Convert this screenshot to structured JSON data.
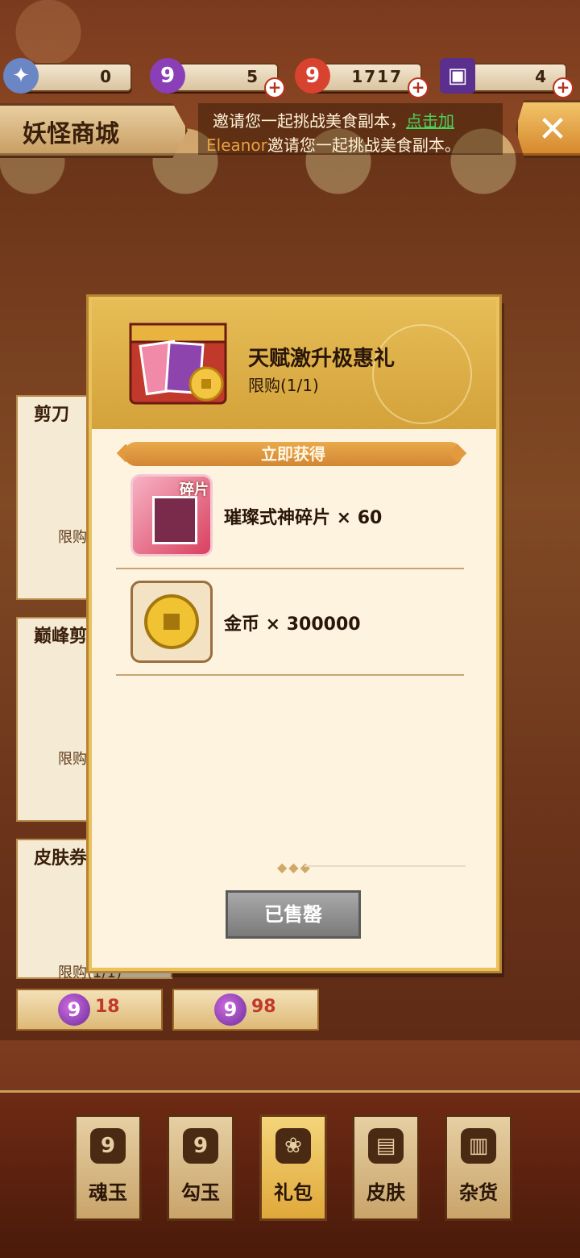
{
  "resources": [
    {
      "icon": "soul-bird-icon",
      "value": "0",
      "color": "#6b86c4"
    },
    {
      "icon": "magatama-purple-icon",
      "value": "5",
      "color": "#8a3fb8"
    },
    {
      "icon": "magatama-red-icon",
      "value": "1717",
      "color": "#d8432f"
    },
    {
      "icon": "ticket-card-icon",
      "value": "4",
      "color": "#5b2f8e"
    }
  ],
  "header": {
    "title": "妖怪商城",
    "marquee_line1": "邀请您一起挑战美食副本，",
    "marquee_link": "点击加",
    "marquee_name": "Eleanor",
    "marquee_line2": "邀请您一起挑战美食副本。"
  },
  "background_cards": [
    {
      "name": "剪刀",
      "limit": "限购(",
      "price": ""
    },
    {
      "name": "巅峰剪",
      "limit": "限购(",
      "price": ""
    },
    {
      "name": "皮肤券",
      "limit": "限购(1/1)",
      "price": "18"
    },
    {
      "name": "",
      "limit": "限购(1/1)",
      "price": "98"
    }
  ],
  "modal": {
    "package_name": "天赋激升极惠礼",
    "limit": "限购(1/1)",
    "ribbon_label": "立即获得",
    "items": [
      {
        "icon": "shard-card-icon",
        "text": "璀璨式神碎片 × 60",
        "badge": "碎片"
      },
      {
        "icon": "gold-coin-icon",
        "text": "金币 × 300000"
      }
    ],
    "sold_out_label": "已售罄"
  },
  "nav": [
    {
      "icon": "soul-jade-icon",
      "label": "魂玉",
      "active": false
    },
    {
      "icon": "magatama-icon",
      "label": "勾玉",
      "active": false
    },
    {
      "icon": "gift-bag-icon",
      "label": "礼包",
      "active": true
    },
    {
      "icon": "kimono-icon",
      "label": "皮肤",
      "active": false
    },
    {
      "icon": "goods-icon",
      "label": "杂货",
      "active": false
    }
  ]
}
